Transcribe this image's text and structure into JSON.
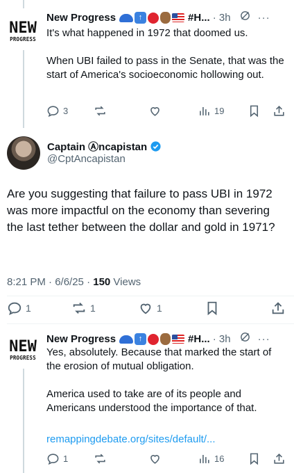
{
  "tweet1": {
    "logo_main": "NEW",
    "logo_sub": "PROGRESS",
    "name": "New Progress",
    "tag": "#H...",
    "time": "· 3h",
    "text": "It's what happened in 1972 that doomed us.\n\nWhen UBI failed to pass in the Senate, that was the start of America's socioeconomic hollowing out.",
    "replies": "3",
    "views": "19"
  },
  "main": {
    "name": "Captain Ⓐncapistan",
    "handle": "@CptAncapistan",
    "text": "Are you suggesting that failure to pass UBI in 1972 was more impactful on the economy than severing the last tether between the dollar and gold in 1971?",
    "time": "8:21 PM · 6/6/25 · ",
    "views_count": "150",
    "views_label": " Views",
    "replies": "1",
    "reposts": "1",
    "likes": "1"
  },
  "tweet2": {
    "logo_main": "NEW",
    "logo_sub": "PROGRESS",
    "name": "New Progress",
    "tag": "#H...",
    "time": "· 3h",
    "text": "Yes, absolutely. Because that marked the start of the erosion of mutual obligation.\n\nAmerica used to take are of its people and Americans understood the importance of that.",
    "link": "remappingdebate.org/sites/default/...",
    "replies": "1",
    "views": "16"
  },
  "colors": {
    "accent": "#1d9bf0",
    "secondary": "#536471",
    "text": "#0f1419"
  }
}
